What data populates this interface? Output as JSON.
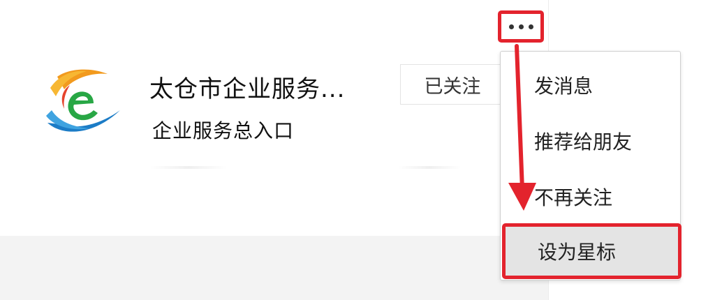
{
  "account": {
    "name": "太仓市企业服务...",
    "description": "企业服务总入口",
    "follow_status": "已关注",
    "logo_icon": "e-letter-logo-icon"
  },
  "more_menu": {
    "trigger_icon": "more-dots-icon",
    "items": [
      {
        "label": "发消息"
      },
      {
        "label": "推荐给朋友"
      },
      {
        "label": "不再关注"
      },
      {
        "label": "设为星标"
      }
    ]
  },
  "annotation": {
    "highlight_color": "#e3232d",
    "arrow_color": "#e3232d"
  }
}
